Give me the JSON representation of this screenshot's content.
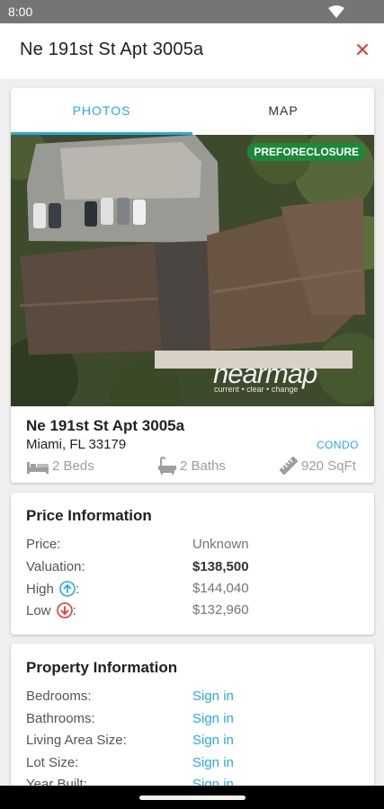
{
  "status_bar": {
    "time": "8:00",
    "wifi_icon": "wifi-icon"
  },
  "header": {
    "title": "Ne 191st St Apt 3005a",
    "close_icon": "close-icon",
    "close_color": "#e53935"
  },
  "tabs": [
    {
      "label": "PHOTOS",
      "active": true
    },
    {
      "label": "MAP",
      "active": false
    }
  ],
  "photo": {
    "badge": "PREFORECLOSURE",
    "badge_color": "#1a8a3a",
    "watermark": "nearmap",
    "watermark_sub": "current • clear • change"
  },
  "property": {
    "address": "Ne 191st St Apt 3005a",
    "city": "Miami, FL 33179",
    "type": "CONDO",
    "beds": "2 Beds",
    "baths": "2 Baths",
    "sqft": "920 SqFt",
    "beds_icon": "bed-icon",
    "baths_icon": "bathtub-icon",
    "sqft_icon": "ruler-icon"
  },
  "price_info": {
    "title": "Price Information",
    "rows": [
      {
        "label": "Price:",
        "value": "Unknown"
      },
      {
        "label": "Valuation:",
        "value": "$138,500"
      },
      {
        "label": "High",
        "suffix": ":",
        "value": "$144,040",
        "icon": "arrow-up-circle-icon"
      },
      {
        "label": "Low",
        "suffix": ":",
        "value": "$132,960",
        "icon": "arrow-down-circle-icon"
      }
    ]
  },
  "property_info": {
    "title": "Property Information",
    "rows": [
      {
        "label": "Bedrooms:",
        "value": "Sign in"
      },
      {
        "label": "Bathrooms:",
        "value": "Sign in"
      },
      {
        "label": "Living Area Size:",
        "value": "Sign in"
      },
      {
        "label": "Lot Size:",
        "value": "Sign in"
      },
      {
        "label": "Year Built:",
        "value": "Sign in"
      }
    ]
  },
  "colors": {
    "accent": "#29a9e0",
    "high": "#29a9e0",
    "low": "#e53935"
  }
}
